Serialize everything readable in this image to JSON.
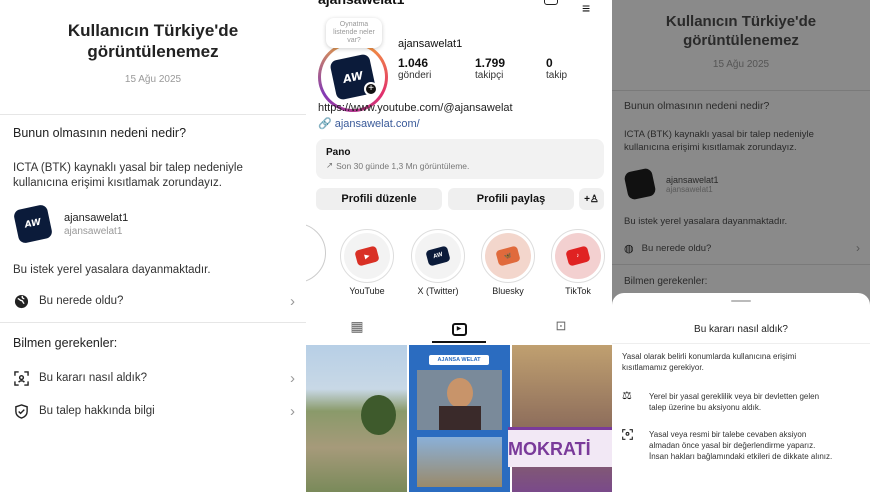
{
  "p1": {
    "title_line1": "Kullanıcın Türkiye'de",
    "title_line2": "görüntülenemez",
    "date": "15 Ağu 2025",
    "why_title": "Bunun olmasının nedeni nedir?",
    "reason_line1": "ICTA (BTK) kaynaklı yasal bir talep nedeniyle",
    "reason_line2": "kullanıcına erişimi kısıtlamak zorundayız.",
    "user_name": "ajansawelat1",
    "user_handle": "ajansawelat1",
    "avatar_text": "AW",
    "local_law": "Bu istek yerel yasalara dayanmaktadır.",
    "where_label": "Bu nerede oldu?",
    "know_title": "Bilmen gerekenler:",
    "decision_label": "Bu kararı nasıl aldık?",
    "request_info_label": "Bu talep hakkında bilgi"
  },
  "p2": {
    "username": "ajansawelat1",
    "note_text": "Oynatma listende neler var?",
    "avatar_text": "AW",
    "stats": [
      {
        "value": "1.046",
        "label": "gönderi"
      },
      {
        "value": "1.799",
        "label": "takipçi"
      },
      {
        "value": "0",
        "label": "takip"
      }
    ],
    "bio_link": "https://www.youtube.com/@ajansawelat",
    "bio_link2": "ajansawelat.com/",
    "pano_title": "Pano",
    "pano_sub": "Son 30 günde 1,3 Mn görüntüleme.",
    "edit_btn": "Profili düzenle",
    "share_btn": "Profili paylaş",
    "highlights": [
      "YouTube",
      "X (Twitter)",
      "Bluesky",
      "TikTok"
    ],
    "reel_banner": "AJANSA WELAT",
    "reel_banner2": "MOKRATİ"
  },
  "p3": {
    "title_line1": "Kullanıcın Türkiye'de",
    "title_line2": "görüntülenemez",
    "date": "15 Ağu 2025",
    "why_title": "Bunun olmasının nedeni nedir?",
    "reason_line1": "ICTA (BTK) kaynaklı yasal bir talep nedeniyle",
    "reason_line2": "kullanıcına erişimi kısıtlamak zorundayız.",
    "user_name": "ajansawelat1",
    "user_handle": "ajansawelat1",
    "local_law": "Bu istek yerel yasalara dayanmaktadır.",
    "where_label": "Bu nerede oldu?",
    "know_title": "Bilmen gerekenler:",
    "sheet_title": "Bu kararı nasıl aldık?",
    "sheet_intro_1": "Yasal olarak belirli konumlarda kullanıcına erişimi",
    "sheet_intro_2": "kısıtlamamız gerekiyor.",
    "sheet_item1_1": "Yerel bir yasal gereklilik veya bir devletten gelen",
    "sheet_item1_2": "talep üzerine bu aksiyonu aldık.",
    "sheet_item2_1": "Yasal veya resmi bir talebe cevaben aksiyon",
    "sheet_item2_2": "almadan önce yasal bir değerlendirme yaparız.",
    "sheet_item2_3": "İnsan hakları bağlamındaki etkileri de dikkate alınız."
  },
  "colors": {
    "accent_link": "#3a5a99",
    "youtube": "#d93025",
    "x_twitter": "#0b1b3a",
    "bluesky": "#e06a3c",
    "tiktok": "#e02222"
  }
}
